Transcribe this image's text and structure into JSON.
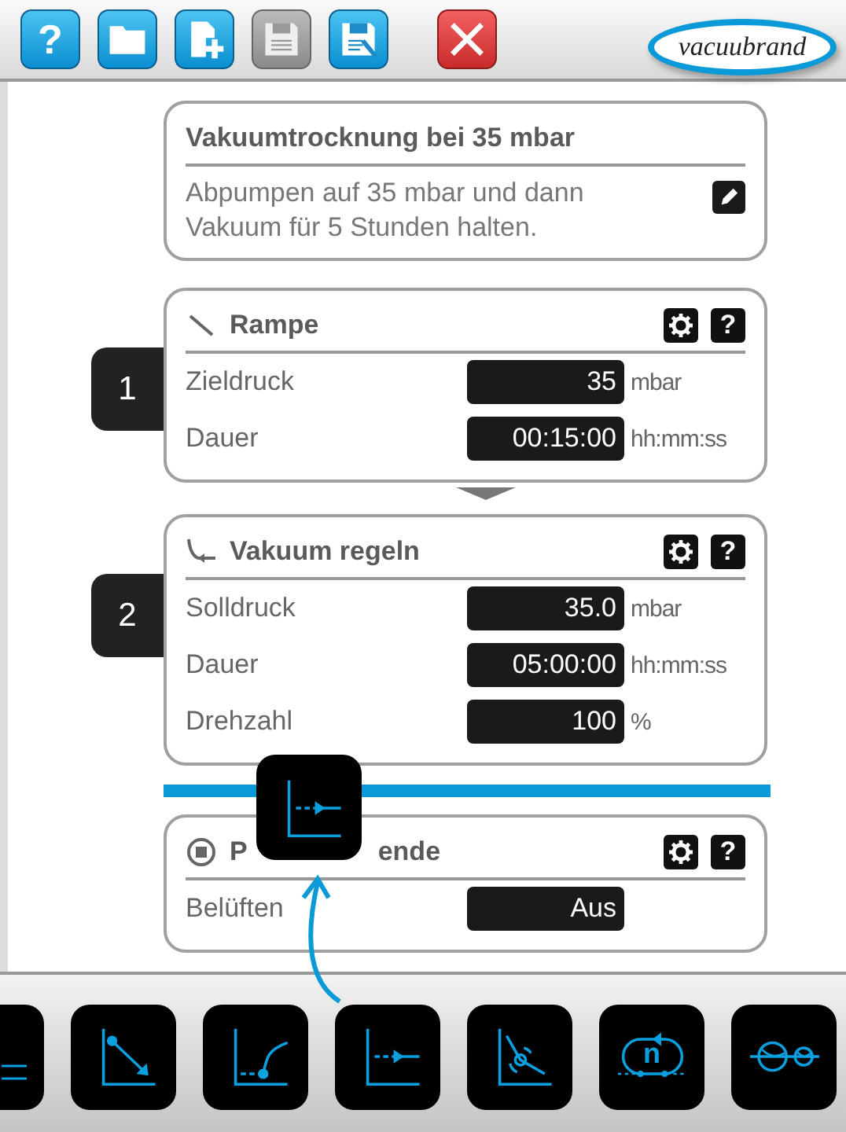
{
  "toolbar": {
    "buttons": [
      {
        "kind": "help",
        "label": "?",
        "disabled": false
      },
      {
        "kind": "open",
        "disabled": false
      },
      {
        "kind": "new",
        "disabled": false
      },
      {
        "kind": "save",
        "disabled": true
      },
      {
        "kind": "save_as",
        "disabled": false
      },
      {
        "kind": "close",
        "disabled": false
      }
    ],
    "logo": "vacuubrand"
  },
  "description": {
    "title": "Vakuumtrocknung bei 35 mbar",
    "text": "Abpumpen auf 35 mbar und dann Vakuum für 5 Stunden halten."
  },
  "steps": [
    {
      "number": "1",
      "kind": "ramp",
      "title_parts": [
        "Rampe"
      ],
      "help": "?",
      "drop_target_before": false,
      "fields": [
        {
          "label": "Zieldruck",
          "value": "35",
          "unit": "mbar"
        },
        {
          "label": "Dauer",
          "value": "00:15:00",
          "unit": "hh:mm:ss"
        }
      ]
    },
    {
      "number": "2",
      "kind": "control",
      "title_parts": [
        "Vakuum regeln"
      ],
      "help": "?",
      "drop_target_before": false,
      "fields": [
        {
          "label": "Solldruck",
          "value": "35.0",
          "unit": "mbar"
        },
        {
          "label": "Dauer",
          "value": "05:00:00",
          "unit": "hh:mm:ss"
        },
        {
          "label": "Drehzahl",
          "value": "100",
          "unit": "%"
        }
      ]
    },
    {
      "kind": "end",
      "title_parts": [
        "P",
        "ende"
      ],
      "help": "?",
      "drop_target_before": true,
      "fields": [
        {
          "label": "Belüften",
          "value": "Aus"
        }
      ]
    }
  ],
  "dragging": {
    "kind": "hold"
  },
  "palette": [
    {
      "kind": "cut"
    },
    {
      "kind": "ramp"
    },
    {
      "kind": "approach"
    },
    {
      "kind": "hold"
    },
    {
      "kind": "speed"
    },
    {
      "kind": "loop",
      "label": "n"
    },
    {
      "kind": "pumps"
    }
  ]
}
